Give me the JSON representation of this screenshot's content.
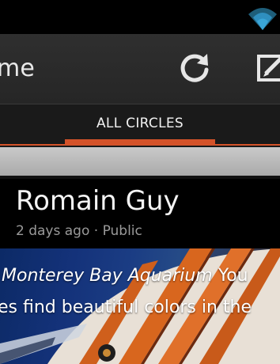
{
  "actionbar": {
    "title": "me",
    "refresh_icon": "refresh-icon",
    "compose_icon": "compose-icon"
  },
  "tabs": {
    "active_label": "ALL CIRCLES"
  },
  "post": {
    "author": "Romain Guy",
    "meta": "2 days ago · Public",
    "caption_line1_italic": "Monterey Bay Aquarium",
    "caption_line1_tail": "You",
    "caption_line2": "es find beautiful colors in the"
  },
  "colors": {
    "accent": "#d4532a",
    "statusbar_icon": "#3aa6d8"
  }
}
